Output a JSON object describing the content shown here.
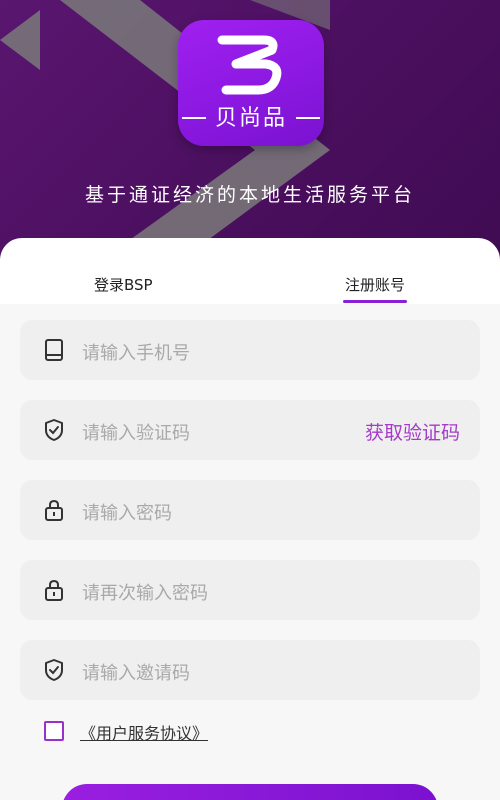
{
  "brand": {
    "logo_name": "贝尚品",
    "slogan": "基于通证经济的本地生活服务平台"
  },
  "tabs": [
    {
      "label": "登录BSP",
      "active": false
    },
    {
      "label": "注册账号",
      "active": true
    }
  ],
  "form": {
    "phone": {
      "placeholder": "请输入手机号",
      "icon": "tablet-icon"
    },
    "code": {
      "placeholder": "请输入验证码",
      "icon": "shield-check-icon",
      "action": "获取验证码"
    },
    "password": {
      "placeholder": "请输入密码",
      "icon": "lock-icon"
    },
    "password_confirm": {
      "placeholder": "请再次输入密码",
      "icon": "lock-icon"
    },
    "invite": {
      "placeholder": "请输入邀请码",
      "icon": "shield-check-icon"
    }
  },
  "agreement": {
    "label": "《用户服务协议》",
    "checked": false
  },
  "colors": {
    "accent": "#8a1fd6",
    "hero": "#4a0f5e",
    "link": "#a53bc9"
  }
}
